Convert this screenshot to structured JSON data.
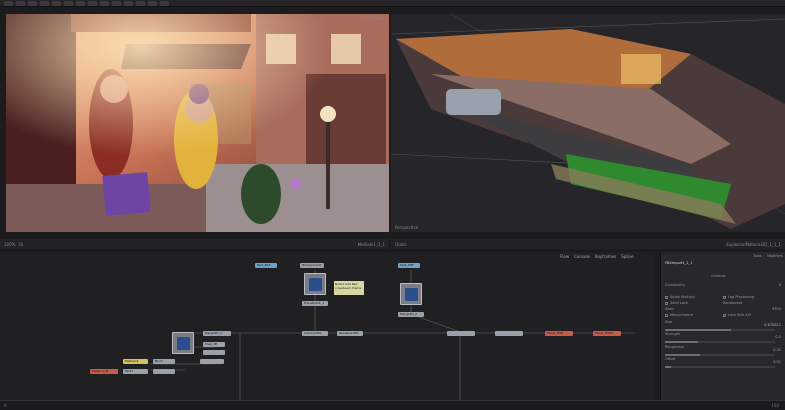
{
  "left_viewer": {
    "title": "",
    "corner": "1920x1080"
  },
  "left_viewer_bar": {
    "view": "100%",
    "fit": "Fit",
    "node": "MediaIn1_1_1"
  },
  "right_viewer": {
    "label": "Perspective"
  },
  "right_viewer_bar": {
    "view": "Quad",
    "node": "ExplosionMaterial3D_1_1_1"
  },
  "node_tabs": {
    "flow": "Flow",
    "console": "Console",
    "keyframes": "Keyframes",
    "spline": "Spline"
  },
  "nodes": [
    {
      "id": "n1",
      "label": "Text_BGF"
    },
    {
      "id": "n2",
      "label": "Background1"
    },
    {
      "id": "n3",
      "label": "Text_DOF"
    },
    {
      "id": "n4",
      "label": "Transform1_1"
    },
    {
      "id": "n5",
      "label": "Merge3D_2"
    },
    {
      "id": "n6",
      "label": "Merge3D_1"
    },
    {
      "id": "n7",
      "label": "Camera3D1"
    },
    {
      "id": "n8",
      "label": "Renderer3D1"
    },
    {
      "id": "n9",
      "label": "Saver_EXR"
    },
    {
      "id": "n10",
      "label": "Saver_EXR2"
    },
    {
      "id": "n11",
      "label": "Fixer_PP"
    },
    {
      "id": "n12",
      "label": "MediaIn1"
    },
    {
      "id": "n13",
      "label": "Blur1"
    },
    {
      "id": "n14",
      "label": "Instance_B"
    },
    {
      "id": "n15",
      "label": "Text1"
    }
  ],
  "sticky_note": "Note1 Add Red crossbeam frame",
  "inspector": {
    "tabs": [
      "Tools",
      "Modifiers"
    ],
    "node_name": "FBXmport1_1_1",
    "controls_label": "Controls",
    "complexity_label": "Complexity",
    "complexity_value": "0",
    "alpha_multiply": "Alpha Multiply",
    "log_processing": "Log Processing",
    "seed_lock": "Seed Lock",
    "randomize": "Randomize",
    "seed_label": "Seed",
    "seed_value": "5303",
    "monochrome": "Monochrome",
    "lock_size": "Lock Size X/Y",
    "size_label": "Size",
    "size_value": "6.876812",
    "strength_label": "Strength",
    "strength_value": "0.3",
    "roughness_label": "Roughness",
    "roughness_value": "0.32",
    "offset_label": "Offset",
    "offset_value": "0.01"
  },
  "timeline": {
    "start": "0",
    "end": "100"
  },
  "colors": {
    "accent": "#d89a2a",
    "node_blue": "#6ea3c8",
    "node_red": "#c85a4a",
    "node_yellow": "#d4c25a"
  }
}
